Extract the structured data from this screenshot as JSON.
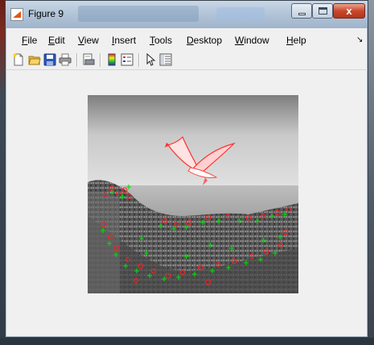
{
  "window": {
    "title": "Figure 9",
    "app_icon": "matlab-icon",
    "controls": {
      "minimize_icon": "minimize-icon",
      "maximize_icon": "maximize-icon",
      "close_label": "x"
    }
  },
  "menubar": {
    "items": [
      {
        "name": "file",
        "label": "File",
        "mnemonic": "F",
        "rest": "ile"
      },
      {
        "name": "edit",
        "label": "Edit",
        "mnemonic": "E",
        "rest": "dit"
      },
      {
        "name": "view",
        "label": "View",
        "mnemonic": "V",
        "rest": "iew"
      },
      {
        "name": "insert",
        "label": "Insert",
        "mnemonic": "I",
        "rest": "nsert"
      },
      {
        "name": "tools",
        "label": "Tools",
        "mnemonic": "T",
        "rest": "ools"
      },
      {
        "name": "desktop",
        "label": "Desktop",
        "mnemonic": "D",
        "rest": "esktop"
      },
      {
        "name": "window",
        "label": "Window",
        "mnemonic": "W",
        "rest": "indow"
      },
      {
        "name": "help",
        "label": "Help",
        "mnemonic": "H",
        "rest": "elp"
      }
    ],
    "overflow_icon": "chevron-dock-icon"
  },
  "toolbar": {
    "icons": [
      "new-figure-icon",
      "open-file-icon",
      "save-icon",
      "print-icon",
      "print-preview-icon",
      "colorbar-icon",
      "legend-icon",
      "pointer-icon",
      "property-editor-icon"
    ]
  },
  "figure": {
    "image_subject": "grayscale photo of a seagull over a coastal cliff, with red-highlighted gull and green feature-point markers along the hillside",
    "marker_colors": {
      "circle": "#ff2020",
      "plus": "#00e000"
    },
    "highlight_color": "#ff3030"
  }
}
